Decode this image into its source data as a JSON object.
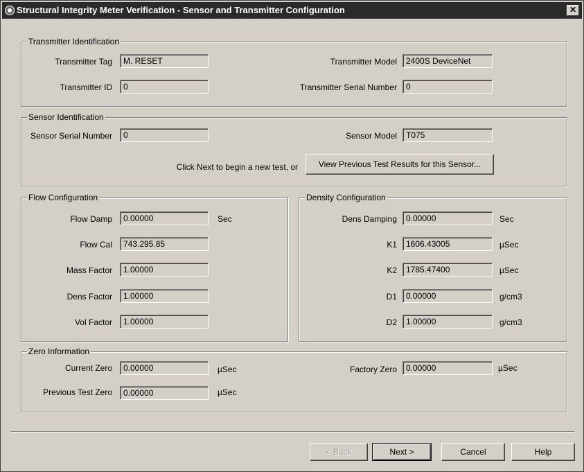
{
  "window": {
    "title": "Structural Integrity Meter Verification - Sensor and Transmitter Configuration",
    "close_label": "✕"
  },
  "transmitter": {
    "legend": "Transmitter Identification",
    "tag_label": "Transmitter Tag",
    "tag_value": "M. RESET",
    "model_label": "Transmitter Model",
    "model_value": "2400S DeviceNet",
    "id_label": "Transmitter ID",
    "id_value": "0",
    "serial_label": "Transmitter Serial Number",
    "serial_value": "0"
  },
  "sensor": {
    "legend": "Sensor Identification",
    "serial_label": "Sensor Serial Number",
    "serial_value": "0",
    "model_label": "Sensor Model",
    "model_value": "T075",
    "hint_text": "Click Next to begin a new test, or",
    "view_button": "View Previous Test Results for this Sensor..."
  },
  "flow": {
    "legend": "Flow Configuration",
    "rows": [
      {
        "label": "Flow Damp",
        "value": "0.00000",
        "unit": "Sec"
      },
      {
        "label": "Flow Cal",
        "value": "743.295.85",
        "unit": ""
      },
      {
        "label": "Mass Factor",
        "value": "1.00000",
        "unit": ""
      },
      {
        "label": "Dens Factor",
        "value": "1.00000",
        "unit": ""
      },
      {
        "label": "Vol Factor",
        "value": "1.00000",
        "unit": ""
      }
    ]
  },
  "density": {
    "legend": "Density Configuration",
    "rows": [
      {
        "label": "Dens Damping",
        "value": "0.00000",
        "unit": "Sec"
      },
      {
        "label": "K1",
        "value": "1606.43005",
        "unit": "µSec"
      },
      {
        "label": "K2",
        "value": "1785.47400",
        "unit": "µSec"
      },
      {
        "label": "D1",
        "value": "0.00000",
        "unit": "g/cm3"
      },
      {
        "label": "D2",
        "value": "1.00000",
        "unit": "g/cm3"
      }
    ]
  },
  "zero": {
    "legend": "Zero Information",
    "current_label": "Current Zero",
    "current_value": "0.00000",
    "current_unit": "µSec",
    "factory_label": "Factory Zero",
    "factory_value": "0.00000",
    "factory_unit": "µSec",
    "previous_label": "Previous Test Zero",
    "previous_value": "0.00000",
    "previous_unit": "µSec"
  },
  "buttons": {
    "back": "< Back",
    "next": "Next >",
    "cancel": "Cancel",
    "help": "Help"
  }
}
